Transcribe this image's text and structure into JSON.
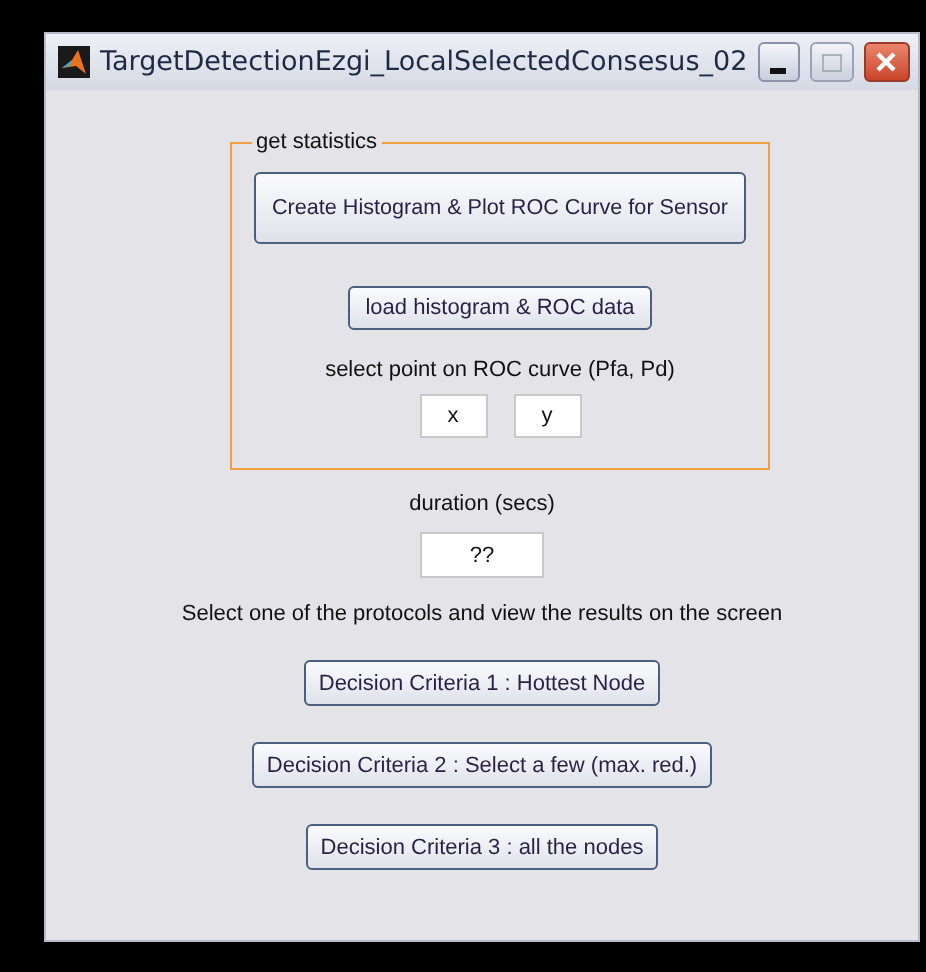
{
  "window": {
    "title": "TargetDetectionEzgi_LocalSelectedConsesus_02"
  },
  "panel": {
    "title": "get statistics",
    "create_button": "Create Histogram & Plot ROC Curve for Sensor",
    "load_button": "load histogram & ROC data",
    "point_label": "select point on ROC curve (Pfa, Pd)",
    "fields": [
      {
        "value": "x"
      },
      {
        "value": "y"
      }
    ]
  },
  "duration": {
    "label": "duration (secs)",
    "value": "??"
  },
  "instruction": "Select one of the protocols and view the results on the screen",
  "criteria_buttons": [
    "Decision Criteria 1 : Hottest Node",
    "Decision Criteria 2 : Select a few (max. red.)",
    "Decision Criteria 3 : all the nodes"
  ]
}
